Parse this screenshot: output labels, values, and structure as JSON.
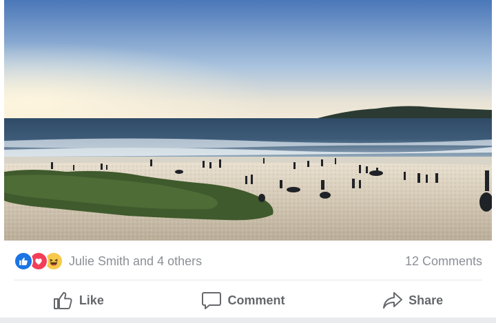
{
  "post": {
    "photo": {
      "alt_icon": "beach-photo"
    },
    "reactions": {
      "icons": [
        "like-reaction-icon",
        "love-reaction-icon",
        "haha-reaction-icon"
      ],
      "summary_text": "Julie Smith and 4 others",
      "comments_text": "12 Comments"
    },
    "actions": {
      "like_label": "Like",
      "comment_label": "Comment",
      "share_label": "Share"
    }
  },
  "colors": {
    "like_blue": "#1b74e4",
    "love_red": "#f33e58",
    "haha_yellow": "#f7c94a",
    "muted_text": "#8b8f96",
    "action_text": "#65676b"
  }
}
